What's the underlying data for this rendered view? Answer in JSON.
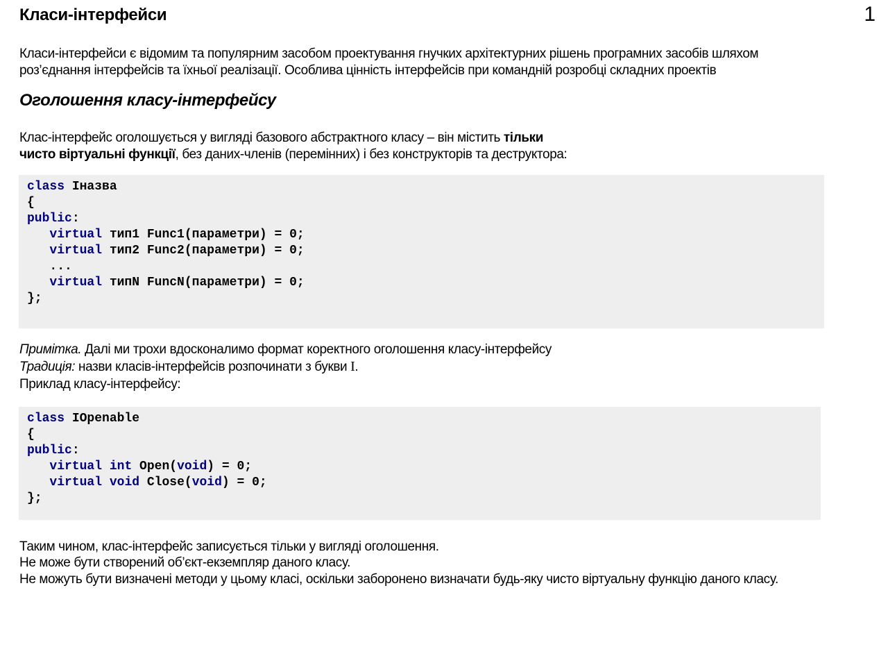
{
  "header": {
    "title": "Класи-інтерфейси",
    "page_number": "1"
  },
  "intro": {
    "line1": "Класи-інтерфейси є відомим та популярним засобом проектування гнучких архітектурних рішень програмних засобів шляхом",
    "line2": "роз’єднання інтерфейсів та їхньої реалізації.  Особлива цінність інтерфейсів при командній розробці складних проектів"
  },
  "section": {
    "heading": "Оголошення класу-інтерфейсу"
  },
  "declaration": {
    "line1_text": "Клас-інтерфейс оголошується  у вигляді базового абстрактного класу – він містить ",
    "line1_bold": "тільки",
    "line2_bold": "чисто віртуальні функції",
    "line2_text": ",  без даних-членів (перемінних) і без конструкторів та деструктора:"
  },
  "code1": {
    "l1_kw": "class",
    "l1_rest": " Іназва",
    "l2": "{",
    "l3_kw": "public",
    "l3_rest": ":",
    "l4_indent": "   ",
    "l4_kw": "virtual",
    "l4_rest": " тип1 Func1(параметри) = 0;",
    "l5_kw": "virtual",
    "l5_rest": " тип2 Func2(параметри) = 0;",
    "l6": "   ...",
    "l7_kw": "virtual",
    "l7_rest": " типN FuncN(параметри) = 0;",
    "l8": "};"
  },
  "notes": {
    "note_label": "Примітка.",
    "note_text": " Далі ми трохи вдосконалимо формат коректного оголошення класу-інтерфейсу",
    "tradition_label": "Традиція:",
    "tradition_text": " назви класів-інтерфейсів  розпочинати з букви ",
    "tradition_letter": "І",
    "tradition_end": ".",
    "example": "Приклад класу-інтерфейсу:"
  },
  "code2": {
    "l1_kw": "class",
    "l1_rest": " IOpenable",
    "l2": "{",
    "l3_kw": "public",
    "l3_rest": ":",
    "l4_kw1": "virtual",
    "l4_kw2": "int",
    "l4_mid": " Open(",
    "l4_kw3": "void",
    "l4_end": ") = 0;",
    "l5_kw1": "virtual",
    "l5_kw2": "void",
    "l5_mid": " Close(",
    "l5_kw3": "void",
    "l5_end": ") = 0;",
    "l6": "};"
  },
  "conclusion": {
    "line1": "Таким чином, клас-інтерфейс записується тільки у вигляді оголошення.",
    "line2": "Не може бути створений об’єкт-екземпляр даного класу.",
    "line3": "Не можуть бути визначені методи у цьому класі, оскільки заборонено визначати будь-яку чисто віртуальну функцію даного класу."
  }
}
